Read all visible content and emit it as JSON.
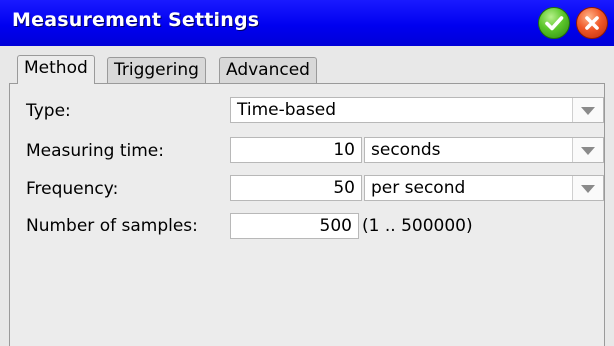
{
  "window": {
    "title": "Measurement Settings",
    "ok_icon": "check-icon",
    "close_icon": "close-icon"
  },
  "tabs": [
    {
      "label": "Method",
      "active": true
    },
    {
      "label": "Triggering",
      "active": false
    },
    {
      "label": "Advanced",
      "active": false
    }
  ],
  "form": {
    "type": {
      "label": "Type:",
      "value": "Time-based"
    },
    "measuring_time": {
      "label": "Measuring time:",
      "value": "10",
      "unit": "seconds"
    },
    "frequency": {
      "label": "Frequency:",
      "value": "50",
      "unit": "per second"
    },
    "samples": {
      "label": "Number of samples:",
      "value": "500",
      "range": "(1 .. 500000)"
    }
  }
}
